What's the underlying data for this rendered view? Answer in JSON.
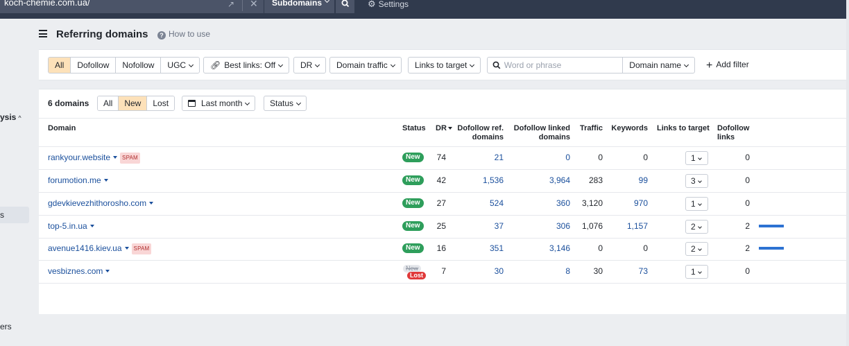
{
  "topbar": {
    "url": "koch-chemie.com.ua/",
    "mode": "Subdomains",
    "settings": "Settings"
  },
  "sidebar": {
    "frag_analysis": "ysis",
    "frag_s": "s",
    "frag_ers": "ers"
  },
  "header": {
    "title": "Referring domains",
    "help": "How to use"
  },
  "filters": {
    "link_types": [
      "All",
      "Dofollow",
      "Nofollow",
      "UGC"
    ],
    "best_links": "Best links: Off",
    "dr": "DR",
    "domain_traffic": "Domain traffic",
    "links_to_target": "Links to target",
    "search_placeholder": "Word or phrase",
    "search_scope": "Domain name",
    "add_filter": "Add filter"
  },
  "results": {
    "count": "6 domains",
    "status_tabs": [
      "All",
      "New",
      "Lost"
    ],
    "period": "Last month",
    "status": "Status"
  },
  "columns": {
    "domain": "Domain",
    "status": "Status",
    "dr": "DR",
    "dofollow_ref_1": "Dofollow ref.",
    "dofollow_ref_2": "domains",
    "dofollow_linked_1": "Dofollow linked",
    "dofollow_linked_2": "domains",
    "traffic": "Traffic",
    "keywords": "Keywords",
    "links_to_target": "Links to target",
    "dofollow_links_1": "Dofollow",
    "dofollow_links_2": "links"
  },
  "rows": [
    {
      "domain": "rankyour.website",
      "spam": "SPAM",
      "status": "New",
      "dr": "74",
      "ref": "21",
      "linked": "0",
      "traffic": "0",
      "keywords": "0",
      "ltt": "1",
      "dlinks": "0",
      "bar": 0
    },
    {
      "domain": "forumotion.me",
      "spam": "",
      "status": "New",
      "dr": "42",
      "ref": "1,536",
      "linked": "3,964",
      "traffic": "283",
      "keywords": "99",
      "ltt": "3",
      "dlinks": "0",
      "bar": 0
    },
    {
      "domain": "gdevkievezhithorosho.com",
      "spam": "",
      "status": "New",
      "dr": "27",
      "ref": "524",
      "linked": "360",
      "traffic": "3,120",
      "keywords": "970",
      "ltt": "1",
      "dlinks": "0",
      "bar": 0
    },
    {
      "domain": "top-5.in.ua",
      "spam": "",
      "status": "New",
      "dr": "25",
      "ref": "37",
      "linked": "306",
      "traffic": "1,076",
      "keywords": "1,157",
      "ltt": "2",
      "dlinks": "2",
      "bar": 1
    },
    {
      "domain": "avenue1416.kiev.ua",
      "spam": "SPAM",
      "status": "New",
      "dr": "16",
      "ref": "351",
      "linked": "3,146",
      "traffic": "0",
      "keywords": "0",
      "ltt": "2",
      "dlinks": "2",
      "bar": 1
    },
    {
      "domain": "vesbiznes.com",
      "spam": "",
      "status": "New",
      "status_lost": "Lost",
      "dr": "7",
      "ref": "30",
      "linked": "8",
      "traffic": "30",
      "keywords": "73",
      "ltt": "1",
      "dlinks": "0",
      "bar": 0
    }
  ],
  "colors": {
    "topbar": "#303a4d",
    "selected": "#fde1b9",
    "link": "#1a4f9c",
    "new_badge": "#2e9e5b",
    "lost_badge": "#e03a3a",
    "bar": "#2d72d2"
  }
}
